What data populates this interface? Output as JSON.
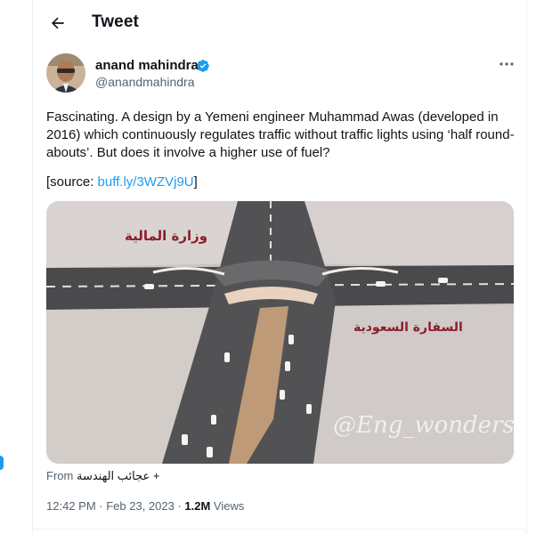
{
  "header": {
    "title": "Tweet",
    "back_icon": "arrow-left-icon"
  },
  "author": {
    "display_name": "anand mahindra",
    "handle": "@anandmahindra",
    "verified_icon": "verified-badge-icon",
    "avatar_icon": "avatar"
  },
  "menu": {
    "more_icon": "more-horizontal-icon"
  },
  "tweet": {
    "text": "Fascinating. A design by a Yemeni engineer Muhammad Awas (developed in 2016) which continuously regulates traffic without traffic lights using ‘half round-abouts’. But does it involve a higher use of fuel?",
    "source_prefix": "[source: ",
    "source_link": "buff.ly/3WZVj9U",
    "source_suffix": "]"
  },
  "media": {
    "label_top_left": "وزارة المالية",
    "label_right": "السفارة السعودية",
    "watermark": "@Eng_wonders"
  },
  "attribution": {
    "prefix": "From",
    "author": "عجائب الهندسة",
    "suffix": "+"
  },
  "meta": {
    "time": "12:42 PM",
    "sep1": " · ",
    "date": "Feb 23, 2023",
    "sep2": " · ",
    "views_count": "1.2M",
    "views_label": " Views"
  },
  "colors": {
    "accent": "#1d9bf0",
    "text": "#0f1419",
    "muted": "#536471",
    "border": "#eff3f4"
  }
}
